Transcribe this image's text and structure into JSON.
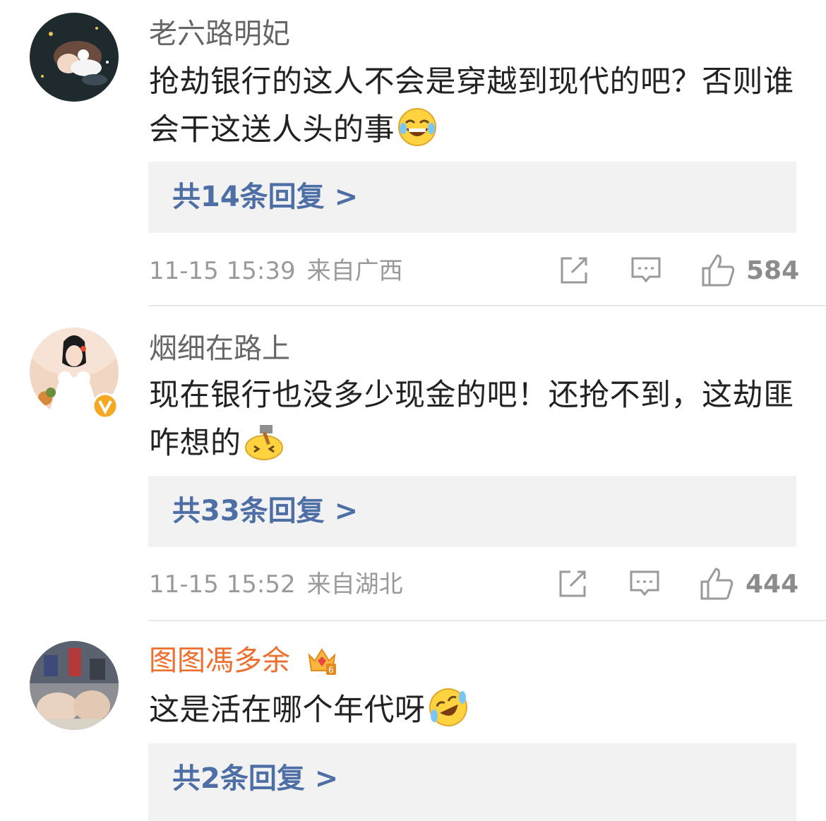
{
  "comments": [
    {
      "username": "老六路明妃",
      "text": "抢劫银行的这人不会是穿越到现代的吧？否则谁会干这送人头的事",
      "emoji": "laughing-tears-emoji",
      "reply_label": "共14条回复 >",
      "date": "11-15 15:39",
      "location": "来自广西",
      "likes": "584"
    },
    {
      "username": "烟细在路上",
      "text": "现在银行也没多少现金的吧！还抢不到，这劫匪咋想的",
      "emoji": "hammer-head-emoji",
      "verified": true,
      "reply_label": "共33条回复 >",
      "date": "11-15 15:52",
      "location": "来自湖北",
      "likes": "444"
    },
    {
      "username": "图图馮多余",
      "text": "这是活在哪个年代呀",
      "emoji": "rofl-emoji",
      "vip_badge": "crown-6-icon",
      "reply_label": "共2条回复 >"
    }
  ],
  "colors": {
    "link": "#4e6fa5",
    "vip_name": "#ee6f2d",
    "meta": "#9a9a9a",
    "reply_bg": "#f2f2f2"
  }
}
